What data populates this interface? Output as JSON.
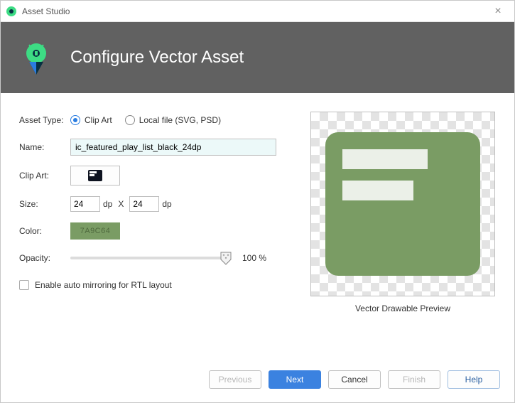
{
  "window": {
    "title": "Asset Studio"
  },
  "header": {
    "title": "Configure Vector Asset"
  },
  "form": {
    "assetType": {
      "label": "Asset Type:",
      "options": {
        "clipArt": "Clip Art",
        "localFile": "Local file (SVG, PSD)"
      },
      "selected": "clipArt"
    },
    "name": {
      "label": "Name:",
      "value": "ic_featured_play_list_black_24dp"
    },
    "clipArt": {
      "label": "Clip Art:"
    },
    "size": {
      "label": "Size:",
      "width": "24",
      "height": "24",
      "unit": "dp",
      "separator": "X"
    },
    "color": {
      "label": "Color:",
      "hex": "7A9C64"
    },
    "opacity": {
      "label": "Opacity:",
      "value": "100 %"
    },
    "mirror": {
      "label": "Enable auto mirroring for RTL layout",
      "checked": false
    }
  },
  "preview": {
    "caption": "Vector Drawable Preview"
  },
  "footer": {
    "previous": "Previous",
    "next": "Next",
    "cancel": "Cancel",
    "finish": "Finish",
    "help": "Help"
  }
}
